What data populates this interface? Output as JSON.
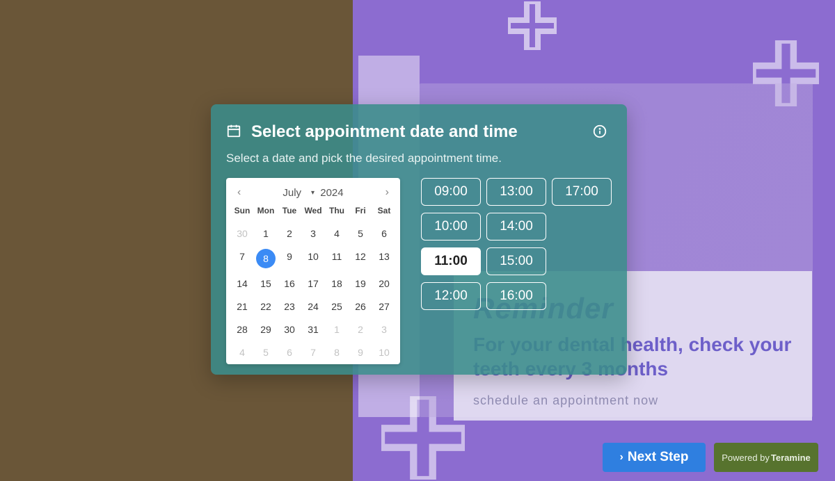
{
  "modal": {
    "title": "Select appointment date and time",
    "subtitle": "Select a date and pick the desired appointment time."
  },
  "calendar": {
    "month": "July",
    "year": "2024",
    "dow": [
      "Sun",
      "Mon",
      "Tue",
      "Wed",
      "Thu",
      "Fri",
      "Sat"
    ],
    "weeks": [
      [
        {
          "d": "30",
          "other": true
        },
        {
          "d": "1"
        },
        {
          "d": "2"
        },
        {
          "d": "3"
        },
        {
          "d": "4"
        },
        {
          "d": "5"
        },
        {
          "d": "6"
        }
      ],
      [
        {
          "d": "7"
        },
        {
          "d": "8",
          "selected": true
        },
        {
          "d": "9"
        },
        {
          "d": "10"
        },
        {
          "d": "11"
        },
        {
          "d": "12"
        },
        {
          "d": "13"
        }
      ],
      [
        {
          "d": "14"
        },
        {
          "d": "15"
        },
        {
          "d": "16"
        },
        {
          "d": "17"
        },
        {
          "d": "18"
        },
        {
          "d": "19"
        },
        {
          "d": "20"
        }
      ],
      [
        {
          "d": "21"
        },
        {
          "d": "22"
        },
        {
          "d": "23"
        },
        {
          "d": "24"
        },
        {
          "d": "25"
        },
        {
          "d": "26"
        },
        {
          "d": "27"
        }
      ],
      [
        {
          "d": "28"
        },
        {
          "d": "29"
        },
        {
          "d": "30"
        },
        {
          "d": "31"
        },
        {
          "d": "1",
          "other": true
        },
        {
          "d": "2",
          "other": true
        },
        {
          "d": "3",
          "other": true
        }
      ],
      [
        {
          "d": "4",
          "other": true
        },
        {
          "d": "5",
          "other": true
        },
        {
          "d": "6",
          "other": true
        },
        {
          "d": "7",
          "other": true
        },
        {
          "d": "8",
          "other": true
        },
        {
          "d": "9",
          "other": true
        },
        {
          "d": "10",
          "other": true
        }
      ]
    ]
  },
  "slots": {
    "columns": [
      [
        "09:00",
        "10:00",
        "11:00",
        "12:00"
      ],
      [
        "13:00",
        "14:00",
        "15:00",
        "16:00"
      ],
      [
        "17:00"
      ]
    ],
    "selected": "11:00"
  },
  "reminder": {
    "title": "Reminder",
    "body": "For your dental health, check your teeth every 3 months",
    "cta": "schedule an appointment now"
  },
  "buttons": {
    "next": "Next Step",
    "powered_prefix": "Powered by",
    "powered_brand": "Teramine"
  }
}
